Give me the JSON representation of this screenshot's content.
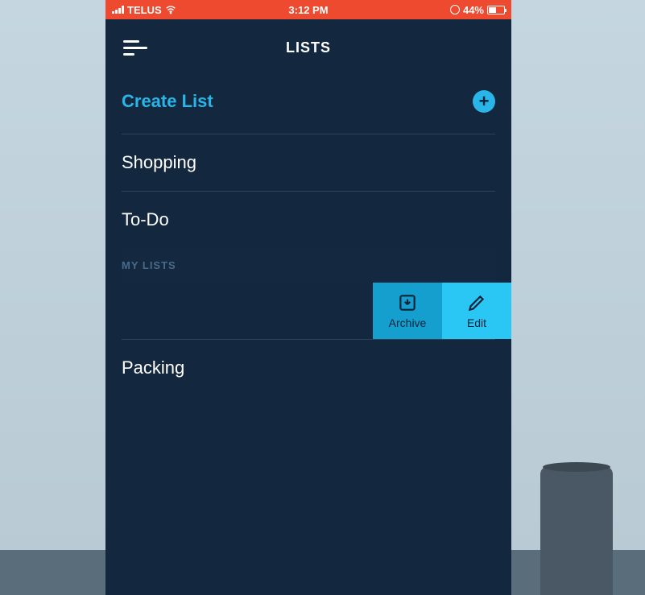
{
  "status": {
    "carrier": "TELUS",
    "time": "3:12 PM",
    "battery_pct": "44%"
  },
  "nav": {
    "title": "LISTS"
  },
  "create": {
    "label": "Create List"
  },
  "default_lists": [
    {
      "label": "Shopping"
    },
    {
      "label": "To-Do"
    }
  ],
  "section_header": "MY LISTS",
  "swipe_actions": {
    "archive": "Archive",
    "edit": "Edit"
  },
  "my_lists": [
    {
      "label": "Packing"
    }
  ]
}
